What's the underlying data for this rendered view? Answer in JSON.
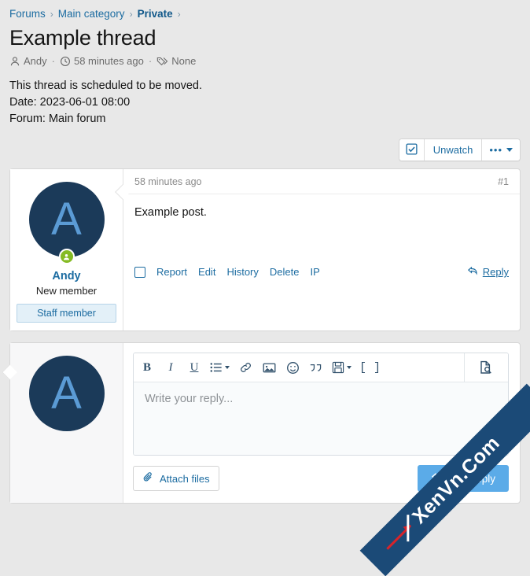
{
  "breadcrumb": {
    "items": [
      {
        "label": "Forums",
        "current": false
      },
      {
        "label": "Main category",
        "current": false
      },
      {
        "label": "Private",
        "current": true
      }
    ],
    "separator": "›"
  },
  "thread": {
    "title": "Example thread",
    "author": "Andy",
    "time": "58 minutes ago",
    "tags": "None",
    "separator": "·",
    "notice_lines": [
      "This thread is scheduled to be moved.",
      "Date: 2023-06-01 08:00",
      "Forum: Main forum"
    ]
  },
  "actionbar": {
    "watch_label": "Unwatch",
    "more_dots": "•••"
  },
  "post": {
    "time": "58 minutes ago",
    "number": "#1",
    "body": "Example post.",
    "user": {
      "avatar_letter": "A",
      "name": "Andy",
      "title": "New member",
      "staff_banner": "Staff member"
    },
    "actions": [
      "Report",
      "Edit",
      "History",
      "Delete",
      "IP"
    ],
    "reply_label": "Reply"
  },
  "reply": {
    "avatar_letter": "A",
    "placeholder": "Write your reply...",
    "toolbar": [
      {
        "name": "bold",
        "glyph": "B",
        "dropdown": false
      },
      {
        "name": "italic",
        "glyph": "I",
        "dropdown": false
      },
      {
        "name": "underline",
        "glyph": "U",
        "dropdown": false
      },
      {
        "name": "list",
        "glyph": "",
        "dropdown": true
      },
      {
        "name": "link",
        "glyph": "",
        "dropdown": false
      },
      {
        "name": "image",
        "glyph": "",
        "dropdown": false
      },
      {
        "name": "smilie",
        "glyph": "",
        "dropdown": false
      },
      {
        "name": "quote",
        "glyph": "",
        "dropdown": false
      },
      {
        "name": "drafts",
        "glyph": "",
        "dropdown": true
      },
      {
        "name": "bbcode",
        "glyph": "[ ]",
        "dropdown": false
      }
    ],
    "preview_title": "Preview",
    "attach_label": "Attach files",
    "post_label": "Post reply"
  },
  "watermark": {
    "text": "XenVn.Com"
  },
  "colors": {
    "page_bg": "#e8e8e8",
    "link": "#1c6ca1",
    "avatar_bg": "#1b3a59",
    "avatar_letter": "#5b9bd5",
    "online_badge": "#85bb24",
    "post_button": "#5babe8",
    "watermark_bg": "#1b4a77",
    "watermark_arrow": "#d8232a"
  }
}
